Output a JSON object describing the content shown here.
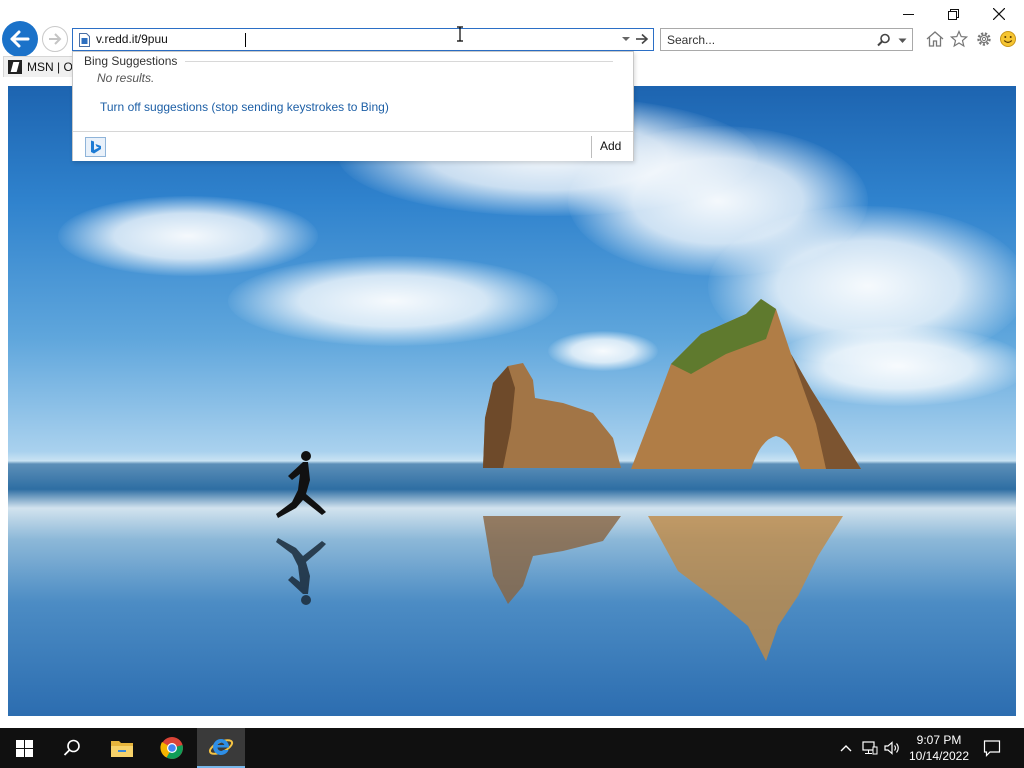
{
  "window": {
    "minimize_icon": "minimize-icon",
    "restore_icon": "restore-icon",
    "close_icon": "close-icon"
  },
  "navigation": {
    "back_icon": "back-arrow-icon",
    "forward_icon": "forward-arrow-icon"
  },
  "address_bar": {
    "value": "v.redd.it/9puu",
    "page_icon": "page-icon",
    "dropdown_icon": "chevron-down-icon",
    "go_icon": "go-arrow-icon"
  },
  "search": {
    "placeholder": "Search...",
    "icon": "magnifier-icon",
    "dropdown_icon": "chevron-down-icon"
  },
  "toolbar": {
    "icons": [
      "home-icon",
      "favorites-star-icon",
      "settings-gear-icon",
      "feedback-smiley-icon"
    ]
  },
  "tabs": [
    {
      "label": "MSN | O",
      "icon": "msn-icon"
    }
  ],
  "suggestions": {
    "header": "Bing Suggestions",
    "no_results": "No results.",
    "turn_off": "Turn off suggestions (stop sending keystrokes to Bing)",
    "provider_icon": "bing-logo-icon",
    "add_label": "Add"
  },
  "taskbar": {
    "items": [
      "windows-start-icon",
      "search-icon",
      "file-explorer-icon",
      "chrome-icon",
      "internet-explorer-icon"
    ],
    "active": "internet-explorer-icon",
    "tray": [
      "chevron-up-icon",
      "network-icon",
      "volume-icon"
    ],
    "notification_icon": "action-center-icon"
  },
  "clock": {
    "time": "9:07 PM",
    "date": "10/14/2022"
  },
  "colors": {
    "accent": "#1b72c9",
    "link": "#1d5fa6",
    "taskbar": "#101010"
  }
}
